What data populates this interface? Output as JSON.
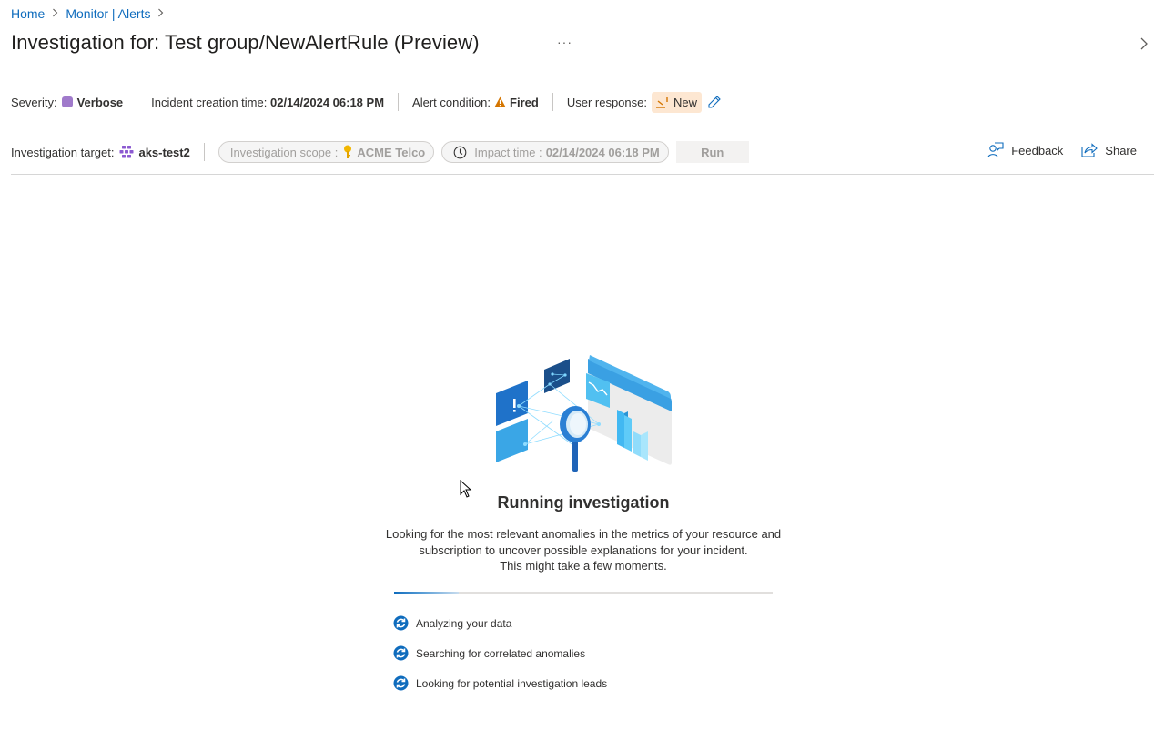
{
  "breadcrumb": {
    "items": [
      "Home",
      "Monitor | Alerts"
    ]
  },
  "header": {
    "title": "Investigation for: Test group/NewAlertRule (Preview)",
    "more_label": "···"
  },
  "details": {
    "severity_label": "Severity:",
    "severity_value": "Verbose",
    "severity_color": "#a07acb",
    "incident_time_label": "Incident creation time:",
    "incident_time_value": "02/14/2024 06:18 PM",
    "alert_condition_label": "Alert condition:",
    "alert_condition_value": "Fired",
    "alert_condition_color": "#d47500",
    "user_response_label": "User response:",
    "user_response_value": "New",
    "user_response_bg": "#fde7d2"
  },
  "investigation": {
    "target_label": "Investigation target:",
    "target_value": "aks-test2",
    "scope_label": "Investigation scope :",
    "scope_value": "ACME Telco",
    "impact_label": "Impact time :",
    "impact_value": "02/14/2024 06:18 PM",
    "run_label": "Run"
  },
  "actions": {
    "feedback_label": "Feedback",
    "share_label": "Share"
  },
  "status": {
    "title": "Running investigation",
    "description_lines": [
      "Looking for the most relevant anomalies in the metrics of your resource and",
      "subscription to uncover possible explanations for your incident.",
      "This might take a few moments."
    ],
    "progress_fraction": 0.17,
    "accent_color": "#0f6cbd",
    "steps": [
      {
        "label": "Analyzing your data",
        "icon": "sync-icon"
      },
      {
        "label": "Searching for correlated anomalies",
        "icon": "sync-icon"
      },
      {
        "label": "Looking for potential investigation leads",
        "icon": "sync-icon"
      }
    ]
  }
}
